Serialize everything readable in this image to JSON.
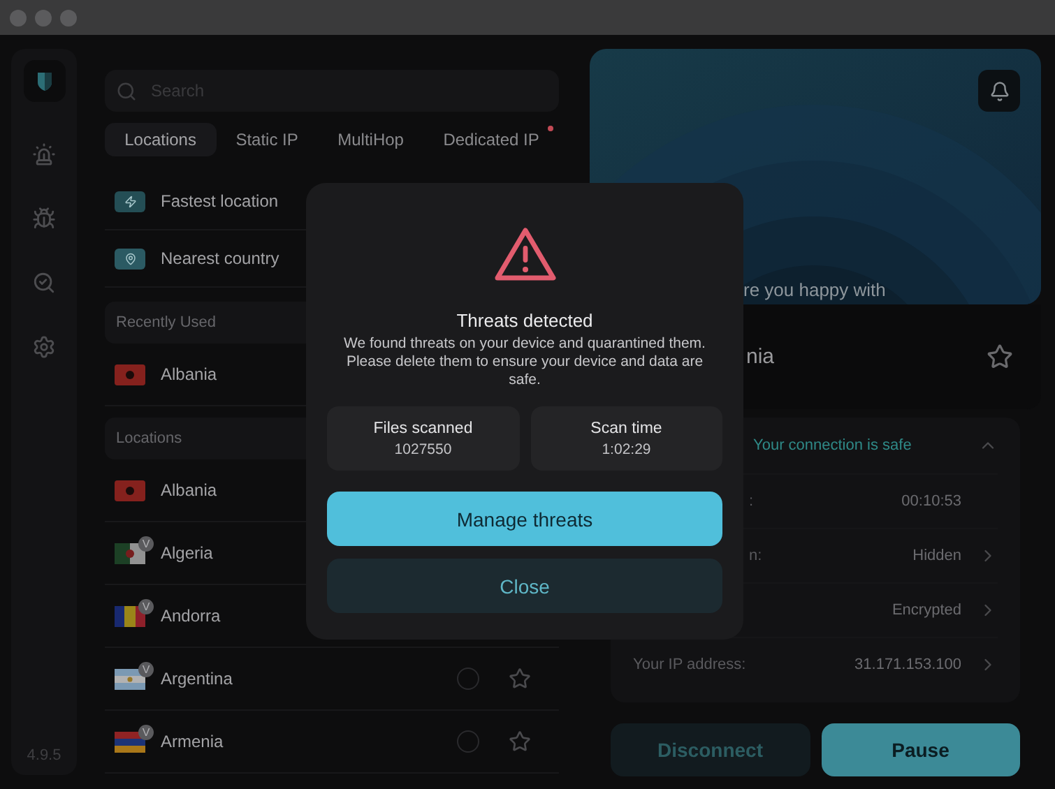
{
  "sidebar": {
    "version": "4.9.5"
  },
  "search": {
    "placeholder": "Search"
  },
  "tabs": [
    {
      "label": "Locations",
      "selected": true,
      "dot": false
    },
    {
      "label": "Static IP",
      "selected": false,
      "dot": false
    },
    {
      "label": "MultiHop",
      "selected": false,
      "dot": false
    },
    {
      "label": "Dedicated IP",
      "selected": false,
      "dot": true
    }
  ],
  "quick_options": [
    {
      "kind": "fastest",
      "label": "Fastest location"
    },
    {
      "kind": "nearest",
      "label": "Nearest country"
    }
  ],
  "recently_used": {
    "title": "Recently Used",
    "rows": [
      {
        "name": "Albania",
        "kind": "albania"
      }
    ]
  },
  "locations": {
    "title": "Locations",
    "rows": [
      {
        "name": "Albania",
        "kind": "albania",
        "badge": ""
      },
      {
        "name": "Algeria",
        "kind": "algeria",
        "badge": "V"
      },
      {
        "name": "Andorra",
        "kind": "andorra",
        "badge": "V"
      },
      {
        "name": "Argentina",
        "kind": "argentina",
        "badge": "V",
        "actions_visible": true
      },
      {
        "name": "Armenia",
        "kind": "armenia",
        "badge": "V",
        "actions_visible": true
      }
    ]
  },
  "hero": {
    "caption": "re you happy with"
  },
  "current_location": {
    "name": "nia"
  },
  "connection": {
    "status": "Your connection is safe",
    "rows": [
      {
        "label": ":",
        "value": "00:10:53",
        "chevron": false
      },
      {
        "label": "n:",
        "value": "Hidden",
        "chevron": true
      },
      {
        "label": "",
        "value": "Encrypted",
        "chevron": true
      },
      {
        "label": "Your IP address:",
        "value": "31.171.153.100",
        "chevron": true
      }
    ]
  },
  "actions": [
    {
      "label": "Disconnect",
      "kind": "secondary"
    },
    {
      "label": "Pause",
      "kind": "primary"
    }
  ],
  "dialog": {
    "title": "Threats detected",
    "message": "We found threats on your device and quarantined them. Please delete them to ensure your device and data are safe.",
    "stats": [
      {
        "label": "Files scanned",
        "value": "1027550"
      },
      {
        "label": "Scan time",
        "value": "1:02:29"
      }
    ],
    "buttons": [
      {
        "label": "Manage threats",
        "kind": "primary"
      },
      {
        "label": "Close",
        "kind": "secondary"
      }
    ]
  }
}
